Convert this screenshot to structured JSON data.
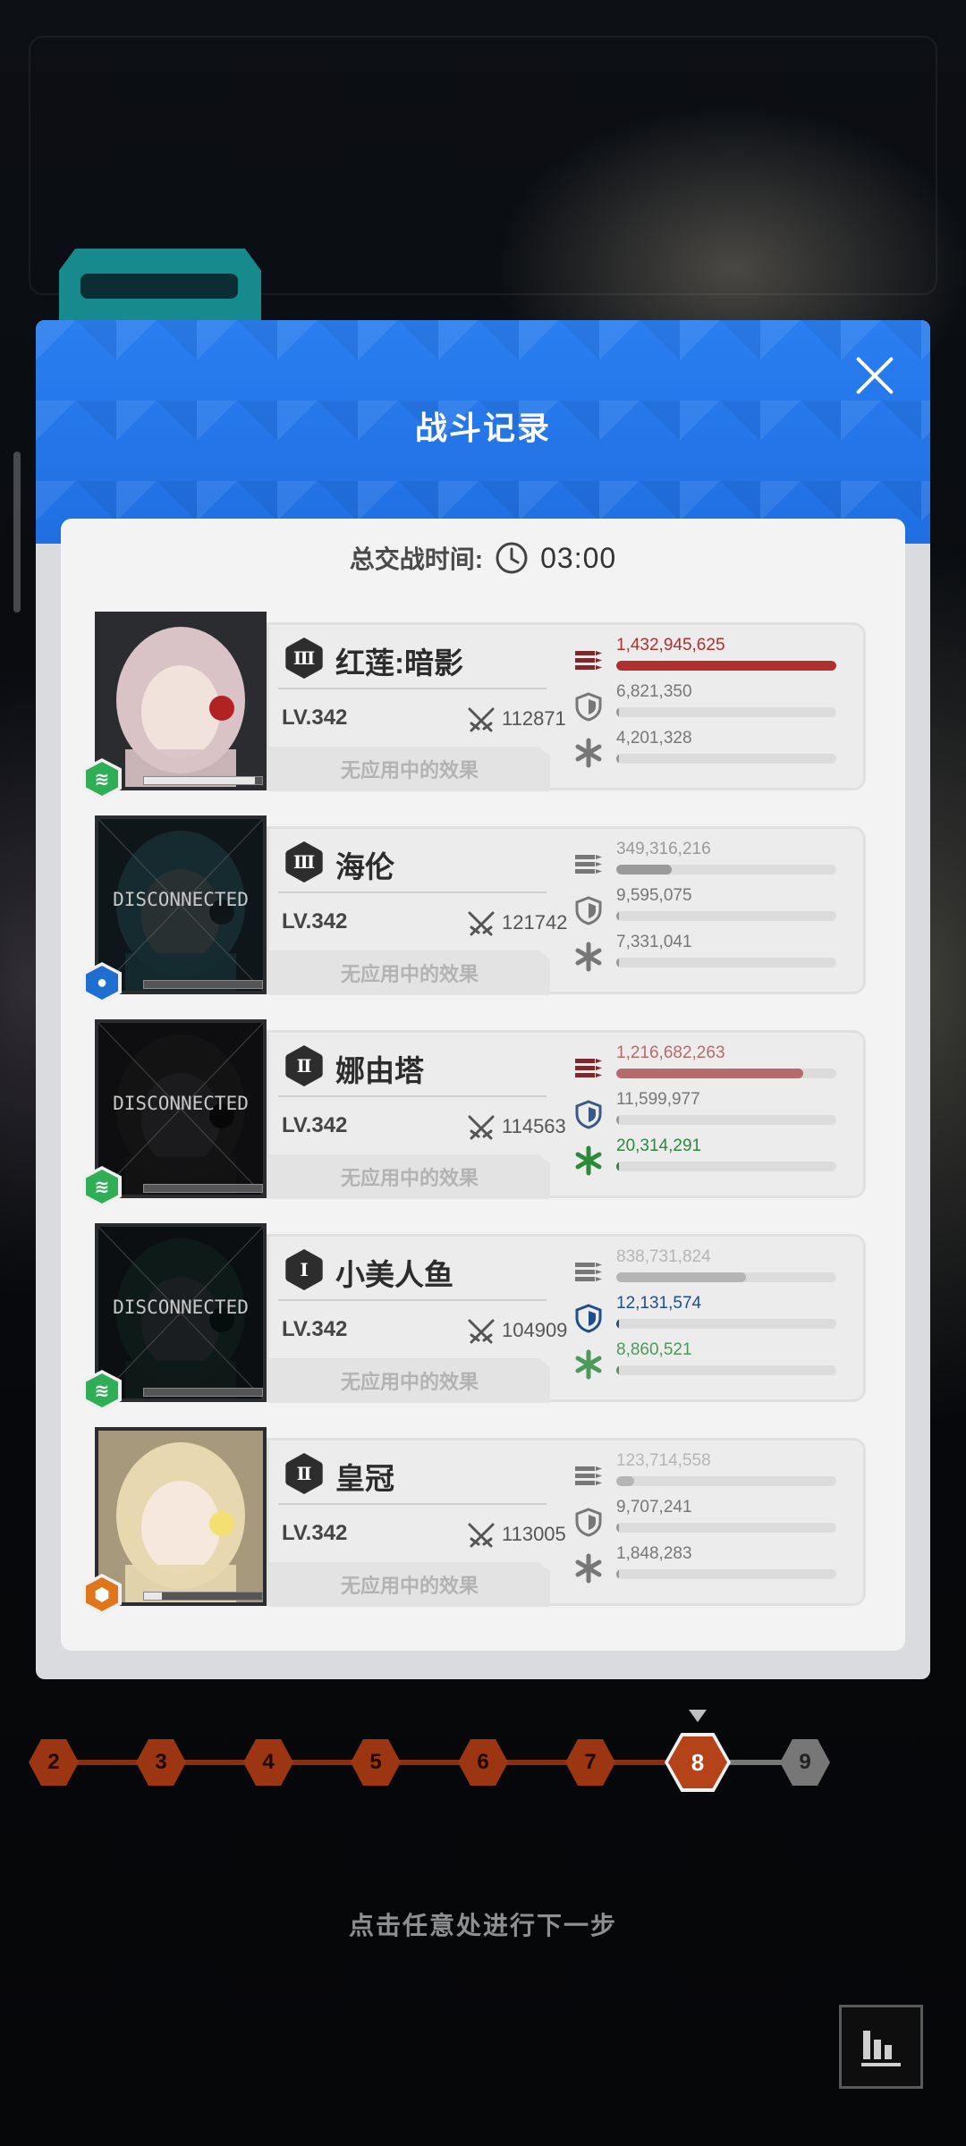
{
  "modal": {
    "title": "战斗记录",
    "battle_time_label": "总交战时间:",
    "battle_time_value": "03:00"
  },
  "players": [
    {
      "name": "红莲:暗影",
      "burst": "Ⅲ",
      "level": "LV.342",
      "power": "112871",
      "effect": "无应用中的效果",
      "disconnected": false,
      "element": "wind",
      "element_color": "#2fae56",
      "portrait_fill": 0.94,
      "damage": "1,432,945,625",
      "damage_fill": 1.0,
      "damage_color": "#b0302f",
      "defense": "6,821,350",
      "defense_fill": 0.0,
      "defense_color": "#999999",
      "heal": "4,201,328",
      "heal_fill": 0.0,
      "heal_color": "#999999",
      "damage_icon_color": "#7a2a2a",
      "defense_icon_color": "#777777",
      "heal_icon_color": "#777777"
    },
    {
      "name": "海伦",
      "burst": "Ⅲ",
      "level": "LV.342",
      "power": "121742",
      "effect": "无应用中的效果",
      "disconnected": true,
      "disconnected_label": "DISCONNECTED",
      "element": "water",
      "element_color": "#1f6fd0",
      "portrait_fill": 0.0,
      "damage": "349,316,216",
      "damage_fill": 0.25,
      "damage_color": "#9a9a9a",
      "defense": "9,595,075",
      "defense_fill": 0.0,
      "defense_color": "#999999",
      "heal": "7,331,041",
      "heal_fill": 0.0,
      "heal_color": "#999999",
      "damage_icon_color": "#777777",
      "defense_icon_color": "#777777",
      "heal_icon_color": "#777777"
    },
    {
      "name": "娜由塔",
      "burst": "Ⅱ",
      "level": "LV.342",
      "power": "114563",
      "effect": "无应用中的效果",
      "disconnected": true,
      "disconnected_label": "DISCONNECTED",
      "element": "wind",
      "element_color": "#2fae56",
      "portrait_fill": 0.0,
      "damage": "1,216,682,263",
      "damage_fill": 0.85,
      "damage_color": "#b86a6a",
      "defense": "11,599,977",
      "defense_fill": 0.0,
      "defense_color": "#999999",
      "heal": "20,314,291",
      "heal_fill": 0.01,
      "heal_color": "#2a8a3a",
      "damage_icon_color": "#7a2a2a",
      "defense_icon_color": "#3a5a86",
      "heal_icon_color": "#2a8a3a"
    },
    {
      "name": "小美人鱼",
      "burst": "Ⅰ",
      "level": "LV.342",
      "power": "104909",
      "effect": "无应用中的效果",
      "disconnected": true,
      "disconnected_label": "DISCONNECTED",
      "element": "wind",
      "element_color": "#2fae56",
      "portrait_fill": 0.0,
      "damage": "838,731,824",
      "damage_fill": 0.59,
      "damage_color": "#b5b5b5",
      "defense": "12,131,574",
      "defense_fill": 0.01,
      "defense_color": "#1f4f8a",
      "heal": "8,860,521",
      "heal_fill": 0.0,
      "heal_color": "#4a9a5a",
      "damage_icon_color": "#777777",
      "defense_icon_color": "#1f4f8a",
      "heal_icon_color": "#4a9a5a"
    },
    {
      "name": "皇冠",
      "burst": "Ⅱ",
      "level": "LV.342",
      "power": "113005",
      "effect": "无应用中的效果",
      "disconnected": false,
      "element": "fire",
      "element_color": "#e0761a",
      "portrait_fill": 0.15,
      "damage": "123,714,558",
      "damage_fill": 0.08,
      "damage_color": "#b5b5b5",
      "defense": "9,707,241",
      "defense_fill": 0.0,
      "defense_color": "#999999",
      "heal": "1,848,283",
      "heal_fill": 0.0,
      "heal_color": "#999999",
      "damage_icon_color": "#777777",
      "defense_icon_color": "#777777",
      "heal_icon_color": "#777777"
    }
  ],
  "stages": {
    "nodes": [
      "2",
      "3",
      "4",
      "5",
      "6",
      "7",
      "8",
      "9"
    ],
    "current": "8"
  },
  "hint": "点击任意处进行下一步",
  "icons": {
    "close": "close-icon",
    "clock": "clock-icon",
    "swords": "crossed-swords-icon",
    "damage": "bullets-icon",
    "defense": "shield-icon",
    "heal": "asterisk-icon",
    "stats": "bar-chart-icon"
  }
}
